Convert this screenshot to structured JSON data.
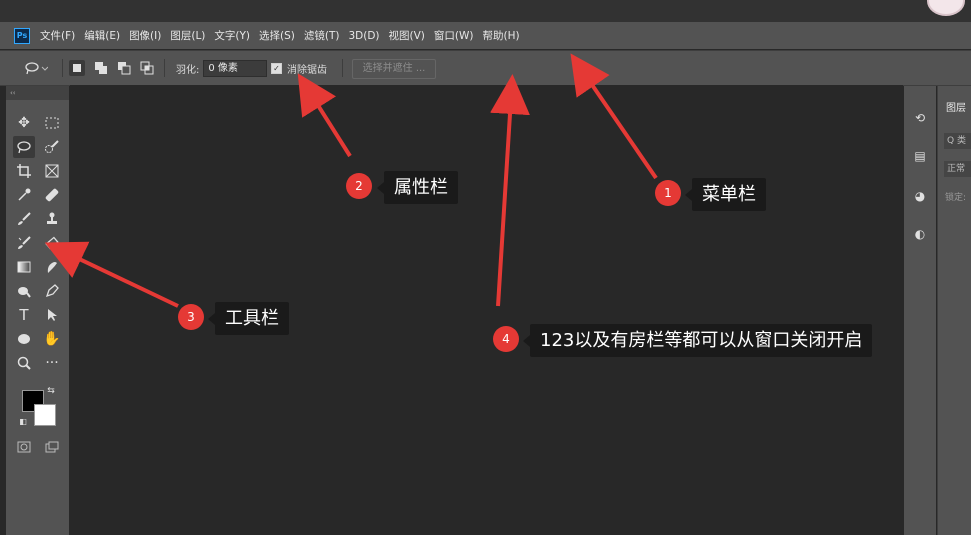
{
  "app": {
    "logo": "Ps"
  },
  "menu": [
    "文件(F)",
    "编辑(E)",
    "图像(I)",
    "图层(L)",
    "文字(Y)",
    "选择(S)",
    "滤镜(T)",
    "3D(D)",
    "视图(V)",
    "窗口(W)",
    "帮助(H)"
  ],
  "options": {
    "feather_label": "羽化:",
    "feather_value": "0 像素",
    "antialias_label": "消除锯齿",
    "select_mask_label": "选择并遮住 ..."
  },
  "right_panel": {
    "tab_label": "图层",
    "search_text": "Q 类",
    "blend_text": "正常",
    "lock_text": "锁定:"
  },
  "annotations": [
    {
      "number": "1",
      "text": "菜单栏"
    },
    {
      "number": "2",
      "text": "属性栏"
    },
    {
      "number": "3",
      "text": "工具栏"
    },
    {
      "number": "4",
      "text": "123以及有房栏等都可以从窗口关闭开启"
    }
  ],
  "colors": {
    "annotation_red": "#e53935",
    "callout_bg": "#1a1a1a",
    "ui_gray": "#535353",
    "canvas": "#282828"
  },
  "icons": [
    "move-icon",
    "marquee-icon",
    "lasso-icon",
    "quick-select-icon",
    "crop-icon",
    "frame-icon",
    "eyedropper-icon",
    "healing-icon",
    "brush-icon",
    "stamp-icon",
    "history-brush-icon",
    "eraser-icon",
    "gradient-icon",
    "smudge-icon",
    "dodge-icon",
    "pen-icon",
    "type-icon",
    "path-select-icon",
    "shape-icon",
    "hand-icon",
    "zoom-icon",
    "more-icon"
  ]
}
